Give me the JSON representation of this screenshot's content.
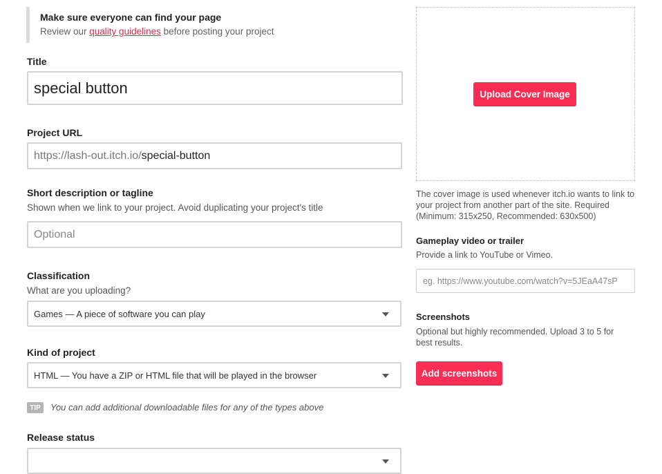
{
  "notice": {
    "title": "Make sure everyone can find your page",
    "text_before": "Review our ",
    "link": "quality guidelines",
    "text_after": " before posting your project"
  },
  "title_field": {
    "label": "Title",
    "value": "special button"
  },
  "url_field": {
    "label": "Project URL",
    "prefix": "https://lash-out.itch.io/",
    "value": "special-button"
  },
  "tagline": {
    "label": "Short description or tagline",
    "help": "Shown when we link to your project. Avoid duplicating your project's title",
    "placeholder": "Optional"
  },
  "classification": {
    "label": "Classification",
    "help": "What are you uploading?",
    "selected": "Games — A piece of software you can play"
  },
  "kind": {
    "label": "Kind of project",
    "selected": "HTML — You have a ZIP or HTML file that will be played in the browser"
  },
  "tip": {
    "badge": "TIP",
    "text": "You can add additional downloadable files for any of the types above"
  },
  "release_status": {
    "label": "Release status"
  },
  "cover": {
    "button": "Upload Cover Image",
    "help": "The cover image is used whenever itch.io wants to link to your project from another part of the site. Required (Minimum: 315x250, Recommended: 630x500)"
  },
  "video": {
    "label": "Gameplay video or trailer",
    "help": "Provide a link to YouTube or Vimeo.",
    "placeholder": "eg. https://www.youtube.com/watch?v=5JEaA47sP"
  },
  "screenshots": {
    "label": "Screenshots",
    "help": "Optional but highly recommended. Upload 3 to 5 for best results.",
    "button": "Add screenshots"
  },
  "colors": {
    "accent": "#fa2e55",
    "link": "#da2c49",
    "border": "#d4d4d4"
  }
}
